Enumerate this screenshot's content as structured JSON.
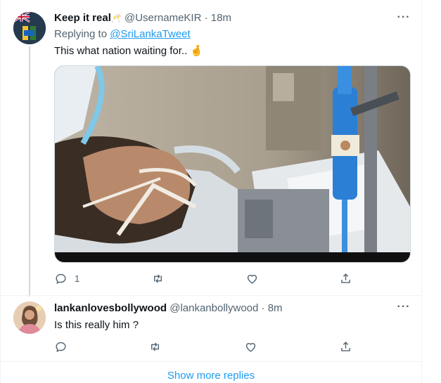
{
  "tweets": [
    {
      "display_name": "Keep it real",
      "name_emoji": "🥂",
      "handle": "@UsernameKIR",
      "separator": "·",
      "time": "18m",
      "reply_prefix": "Replying to ",
      "reply_target": "@SriLankaTweet",
      "text": "This what nation waiting for.. 🤞",
      "reply_count": "1",
      "more_label": "···"
    },
    {
      "display_name": "lankanlovesbollywood",
      "handle": "@lankanbollywood",
      "separator": "·",
      "time": "8m",
      "text": "Is this really him ?",
      "more_label": "···"
    }
  ],
  "show_more_replies": "Show more replies",
  "icons": [
    "avatar-flag-icon",
    "reply-icon",
    "retweet-icon",
    "like-icon",
    "share-icon",
    "more-icon"
  ],
  "colors": {
    "accent": "#1d9bf0",
    "muted": "#536471",
    "text": "#0f1419",
    "border": "#cfd9de"
  }
}
